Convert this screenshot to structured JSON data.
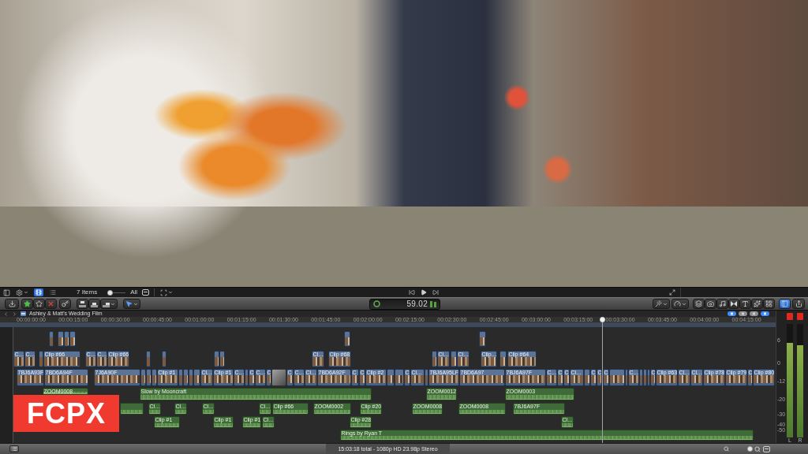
{
  "viewer_bar": {
    "browser_views": [
      {
        "selected": true
      },
      {
        "selected": false
      }
    ],
    "item_count": "7 Items",
    "clip_size": {
      "level": 0.1
    },
    "filter": "All"
  },
  "toolbar": {
    "timecode": "59.02",
    "inspector": {
      "on": true
    }
  },
  "timeline": {
    "title": "Ashley & Matt's Wedding Film",
    "toggles": [
      {
        "on": true
      },
      {
        "on": false
      },
      {
        "on": false
      },
      {
        "on": true
      }
    ],
    "ruler": [
      "00:00:00:00",
      "00:00:15:00",
      "00:00:30:00",
      "00:00:45:00",
      "00:01:00:00",
      "00:01:15:00",
      "00:01:30:00",
      "00:01:45:00",
      "00:02:00:00",
      "00:02:15:00",
      "00:02:30:00",
      "00:02:45:00",
      "00:03:00:00",
      "00:03:15:00",
      "00:03:30:00",
      "00:03:45:00",
      "00:04:00:00",
      "00:04:15:00"
    ],
    "upper_row_2": [
      {
        "kind": "video"
      },
      {
        "kind": "video"
      },
      {
        "kind": "video"
      },
      {
        "kind": "video"
      },
      {
        "kind": "video"
      },
      {
        "kind": "video"
      }
    ],
    "upper_row_1": [
      {
        "kind": "video",
        "label": "C…"
      },
      {
        "kind": "video",
        "label": "C…"
      },
      {
        "kind": "video"
      },
      {
        "kind": "video",
        "label": "Clip #66"
      },
      {
        "kind": "video",
        "label": "C…"
      },
      {
        "kind": "video",
        "label": "C…"
      },
      {
        "kind": "video",
        "label": "Clip #66"
      },
      {
        "kind": "video"
      },
      {
        "kind": "video"
      },
      {
        "kind": "video"
      },
      {
        "kind": "video"
      },
      {
        "kind": "video",
        "label": "Cl…"
      },
      {
        "kind": "video",
        "label": "Clip #68"
      },
      {
        "kind": "video"
      },
      {
        "kind": "video",
        "label": "Cl…"
      },
      {
        "kind": "video"
      },
      {
        "kind": "video",
        "label": "Cl…"
      },
      {
        "kind": "video",
        "label": "Clip…"
      },
      {
        "kind": "video"
      },
      {
        "kind": "video",
        "label": "Clip #64"
      }
    ],
    "storyline": [
      {
        "kind": "video",
        "label": "7BJ6A93F"
      },
      {
        "kind": "video",
        "label": "7BD6A94F"
      },
      {
        "kind": "video",
        "label": "7J6A90F"
      },
      {
        "kind": "video"
      },
      {
        "kind": "video"
      },
      {
        "kind": "video"
      },
      {
        "kind": "video",
        "label": "Clip #1"
      },
      {
        "kind": "video"
      },
      {
        "kind": "video"
      },
      {
        "kind": "video"
      },
      {
        "kind": "video"
      },
      {
        "kind": "video",
        "label": "Cl…"
      },
      {
        "kind": "video",
        "label": "Clip #1"
      },
      {
        "kind": "video",
        "label": "C…"
      },
      {
        "kind": "video"
      },
      {
        "kind": "video",
        "label": "C"
      },
      {
        "kind": "video",
        "label": "C…"
      },
      {
        "kind": "video",
        "label": "C"
      },
      {
        "kind": "generator"
      },
      {
        "kind": "video",
        "label": "C"
      },
      {
        "kind": "video",
        "label": "C…"
      },
      {
        "kind": "video",
        "label": "Cl…"
      },
      {
        "kind": "video",
        "label": "7BD6A92F"
      },
      {
        "kind": "video",
        "label": "C"
      },
      {
        "kind": "video",
        "label": "C"
      },
      {
        "kind": "video",
        "label": "Clip #2"
      },
      {
        "kind": "video"
      },
      {
        "kind": "video"
      },
      {
        "kind": "video",
        "label": "C"
      },
      {
        "kind": "video",
        "label": "Cl…"
      },
      {
        "kind": "video"
      },
      {
        "kind": "video",
        "label": "7BJ6A95LF"
      },
      {
        "kind": "video",
        "label": "7BD6A97"
      },
      {
        "kind": "video",
        "label": "7BJ6A97F"
      },
      {
        "kind": "video",
        "label": "C…"
      },
      {
        "kind": "video",
        "label": "C"
      },
      {
        "kind": "video",
        "label": "C"
      },
      {
        "kind": "video",
        "label": "Cl…"
      },
      {
        "kind": "video"
      },
      {
        "kind": "video",
        "label": "C"
      },
      {
        "kind": "video",
        "label": "C"
      },
      {
        "kind": "video",
        "label": "C"
      },
      {
        "kind": "video"
      },
      {
        "kind": "video"
      },
      {
        "kind": "video",
        "label": "C…"
      },
      {
        "kind": "video"
      },
      {
        "kind": "video"
      },
      {
        "kind": "video"
      },
      {
        "kind": "video",
        "label": "C"
      },
      {
        "kind": "video",
        "label": "Clip #63"
      },
      {
        "kind": "video",
        "label": "Cl…"
      },
      {
        "kind": "video",
        "label": "Cl…"
      },
      {
        "kind": "video",
        "label": "Clip #78"
      },
      {
        "kind": "video",
        "label": "Clip #79"
      },
      {
        "kind": "video",
        "label": "C"
      },
      {
        "kind": "video",
        "label": "Clip #80"
      }
    ],
    "audio_row_1": [
      {
        "kind": "audio",
        "label": "ZOOM0008"
      },
      {
        "kind": "audio",
        "label": "Slow by Mooncraft"
      },
      {
        "kind": "audio",
        "label": "ZOOM0012"
      },
      {
        "kind": "audio",
        "label": "ZOOM0003"
      }
    ],
    "audio_row_2": [
      {
        "kind": "audio"
      },
      {
        "kind": "audio",
        "label": "Cl…"
      },
      {
        "kind": "audio",
        "label": "Cl…"
      },
      {
        "kind": "audio",
        "label": "Cl…"
      },
      {
        "kind": "audio",
        "label": "Cl…"
      },
      {
        "kind": "audio",
        "label": "Clip #66"
      },
      {
        "kind": "audio",
        "label": "ZOOM0002"
      },
      {
        "kind": "audio",
        "label": "Clip #20"
      },
      {
        "kind": "audio",
        "label": "ZOOM0008"
      },
      {
        "kind": "audio",
        "label": "ZOOM0008"
      },
      {
        "kind": "audio",
        "label": "7BJ6A97F"
      }
    ],
    "audio_row_3": [
      {
        "kind": "audio",
        "label": "Clip #1"
      },
      {
        "kind": "audio",
        "label": "Clip #1"
      },
      {
        "kind": "audio",
        "label": "Clip #1"
      },
      {
        "kind": "audio",
        "label": "Cl…"
      },
      {
        "kind": "audio",
        "label": "Clip #28"
      },
      {
        "kind": "audio",
        "label": "Cl…"
      }
    ],
    "audio_row_4": [
      {
        "kind": "audio",
        "label": "Rings by Ryan T"
      }
    ]
  },
  "audio_meters": {
    "scale": [
      "6",
      "0",
      "-12",
      "-20",
      "-30",
      "-40",
      "-50"
    ],
    "channels": [
      {
        "name": "L",
        "level": 0.83,
        "clipped": true
      },
      {
        "name": "R",
        "level": 0.81,
        "clipped": true
      }
    ]
  },
  "status_bar": {
    "info": "15:03:18 total - 1080p HD 23.98p Stereo",
    "zoom": {
      "level": 0.9
    }
  },
  "badge": "FCPX"
}
